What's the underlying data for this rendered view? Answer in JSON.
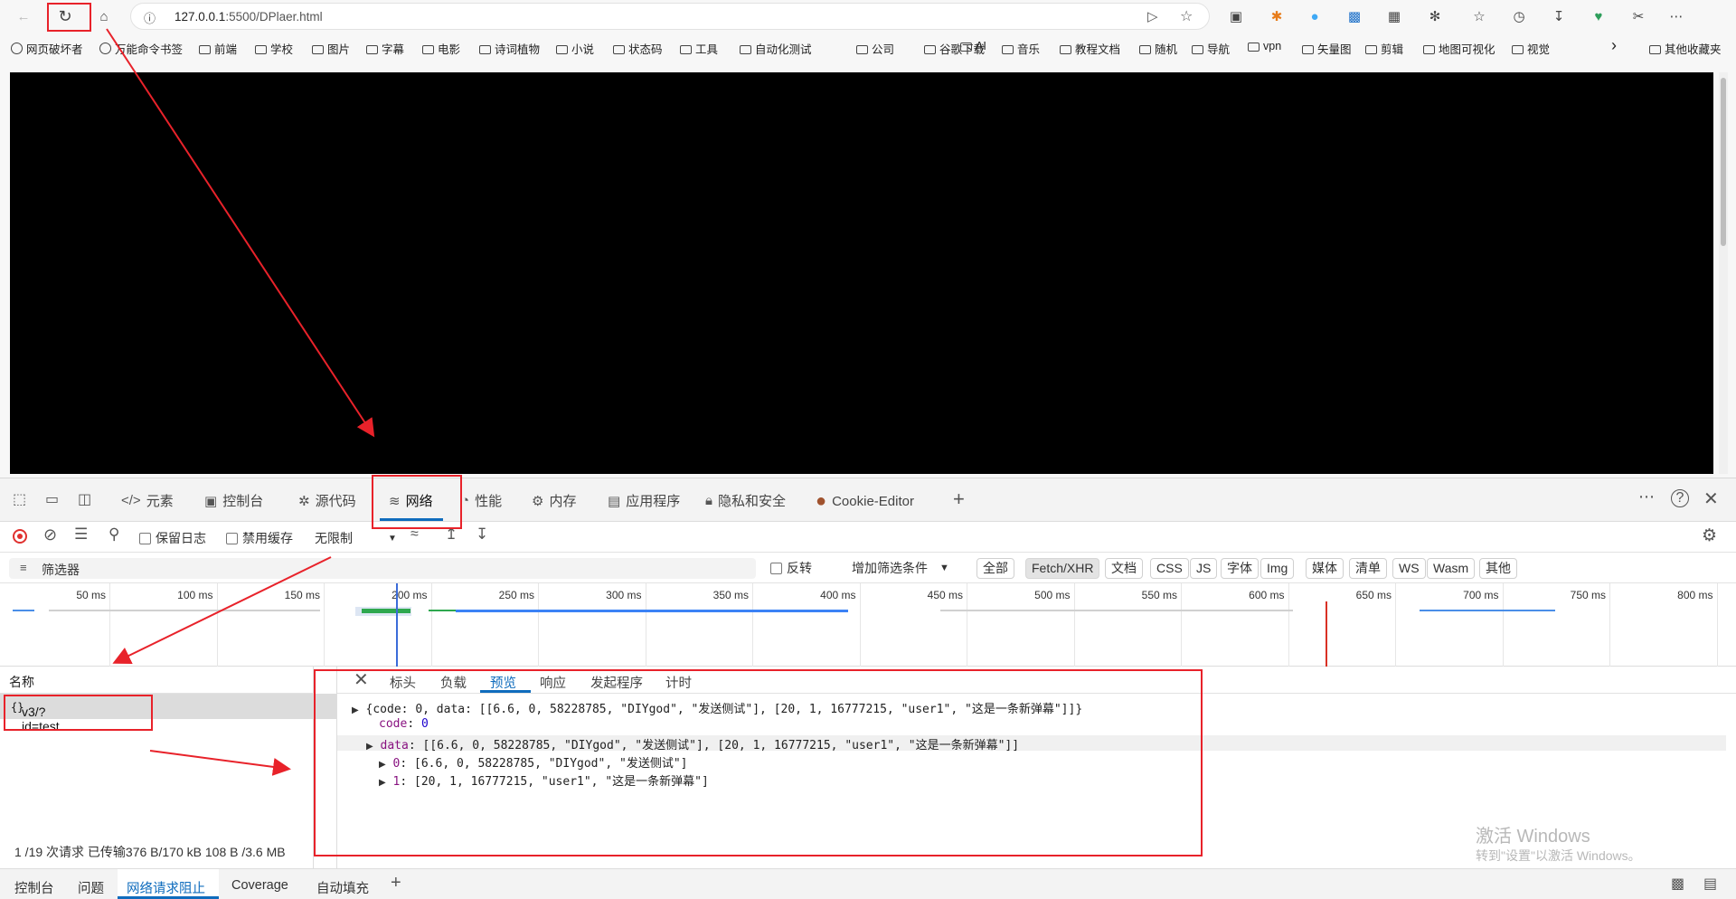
{
  "browser": {
    "address": {
      "info_icon": "info-icon",
      "url_host": "127.0.0.1",
      "url_rest": ":5500/DPlaer.html"
    },
    "buttons": [
      "back-icon",
      "reload-icon",
      "home-icon"
    ]
  },
  "bookmarks": [
    {
      "label": "网页破坏者",
      "icon": "globe-icon"
    },
    {
      "label": "万能命令书签",
      "icon": "globe-icon"
    },
    {
      "label": "前端",
      "icon": "folder-icon"
    },
    {
      "label": "学校",
      "icon": "folder-icon"
    },
    {
      "label": "图片",
      "icon": "folder-icon"
    },
    {
      "label": "字幕",
      "icon": "folder-icon"
    },
    {
      "label": "电影",
      "icon": "folder-icon"
    },
    {
      "label": "诗词植物",
      "icon": "folder-icon"
    },
    {
      "label": "小说",
      "icon": "folder-icon"
    },
    {
      "label": "状态码",
      "icon": "folder-icon"
    },
    {
      "label": "工具",
      "icon": "folder-icon"
    },
    {
      "label": "自动化测试",
      "icon": "folder-icon"
    },
    {
      "label": "公司",
      "icon": "folder-icon"
    },
    {
      "label": "谷歌下载",
      "icon": "folder-icon"
    },
    {
      "label": "AI",
      "icon": "folder-icon"
    },
    {
      "label": "音乐",
      "icon": "folder-icon"
    },
    {
      "label": "教程文档",
      "icon": "folder-icon"
    },
    {
      "label": "随机",
      "icon": "folder-icon"
    },
    {
      "label": "导航",
      "icon": "folder-icon"
    },
    {
      "label": "vpn",
      "icon": "folder-icon"
    },
    {
      "label": "矢量图",
      "icon": "folder-icon"
    },
    {
      "label": "剪辑",
      "icon": "folder-icon"
    },
    {
      "label": "地图可视化",
      "icon": "folder-icon"
    },
    {
      "label": "视觉",
      "icon": "folder-icon"
    }
  ],
  "bookmarks_more": "其他收藏夹",
  "devtools": {
    "tabs": [
      {
        "label": "元素",
        "icon": "code-icon"
      },
      {
        "label": "控制台",
        "icon": "console-icon"
      },
      {
        "label": "源代码",
        "icon": "bug-icon"
      },
      {
        "label": "网络",
        "icon": "wifi-icon"
      },
      {
        "label": "性能",
        "icon": "gauge-icon"
      },
      {
        "label": "内存",
        "icon": "chip-icon"
      },
      {
        "label": "应用程序",
        "icon": "app-icon"
      },
      {
        "label": "隐私和安全",
        "icon": "lock-icon"
      },
      {
        "label": "Cookie-Editor",
        "icon": "cookie-icon"
      }
    ],
    "toolbar": {
      "preserve_log": "保留日志",
      "disable_cache": "禁用缓存",
      "throttle": "无限制"
    },
    "filter": {
      "placeholder": "筛选器",
      "invert": "反转",
      "more_filters": "增加筛选条件",
      "types": [
        "全部",
        "Fetch/XHR",
        "文档",
        "CSS",
        "JS",
        "字体",
        "Img",
        "媒体",
        "清单",
        "WS",
        "Wasm",
        "其他"
      ],
      "active_type": "Fetch/XHR"
    },
    "timeline_ticks": [
      "50 ms",
      "100 ms",
      "150 ms",
      "200 ms",
      "250 ms",
      "300 ms",
      "350 ms",
      "400 ms",
      "450 ms",
      "500 ms",
      "550 ms",
      "600 ms",
      "650 ms",
      "700 ms",
      "750 ms",
      "800 ms"
    ],
    "request_list": {
      "header": "名称",
      "rows": [
        {
          "name": "v3/?id=test",
          "icon": "json-icon"
        }
      ],
      "summary": "1 /19 次请求   已传输376 B/170 kB   108 B /3.6 MB"
    },
    "detail_tabs": [
      "标头",
      "负载",
      "预览",
      "响应",
      "发起程序",
      "计时"
    ],
    "active_detail_tab": "预览",
    "preview": {
      "line_root": "{code: 0, data: [[6.6, 0, 58228785, \"DIYgod\", \"发送侧试\"], [20, 1, 16777215, \"user1\", \"这是一条新弹幕\"]]}",
      "code_key": "code",
      "code_value": "0",
      "data_key": "data",
      "data_value": "[[6.6, 0, 58228785, \"DIYgod\", \"发送侧试\"], [20, 1, 16777215, \"user1\", \"这是一条新弹幕\"]]",
      "item0_key": "0",
      "item0_value": "[6.6, 0, 58228785, \"DIYgod\", \"发送侧试\"]",
      "item1_key": "1",
      "item1_value": "[20, 1, 16777215, \"user1\", \"这是一条新弹幕\"]"
    },
    "drawer_tabs": [
      "控制台",
      "问题",
      "网络请求阻止",
      "Coverage",
      "自动填充"
    ],
    "active_drawer_tab": "网络请求阻止"
  },
  "watermark": {
    "line1": "激活 Windows",
    "line2": "转到\"设置\"以激活 Windows。"
  },
  "colors": {
    "accent": "#0f6cbd",
    "annotation": "#e8222a",
    "viewport": "#000000"
  }
}
